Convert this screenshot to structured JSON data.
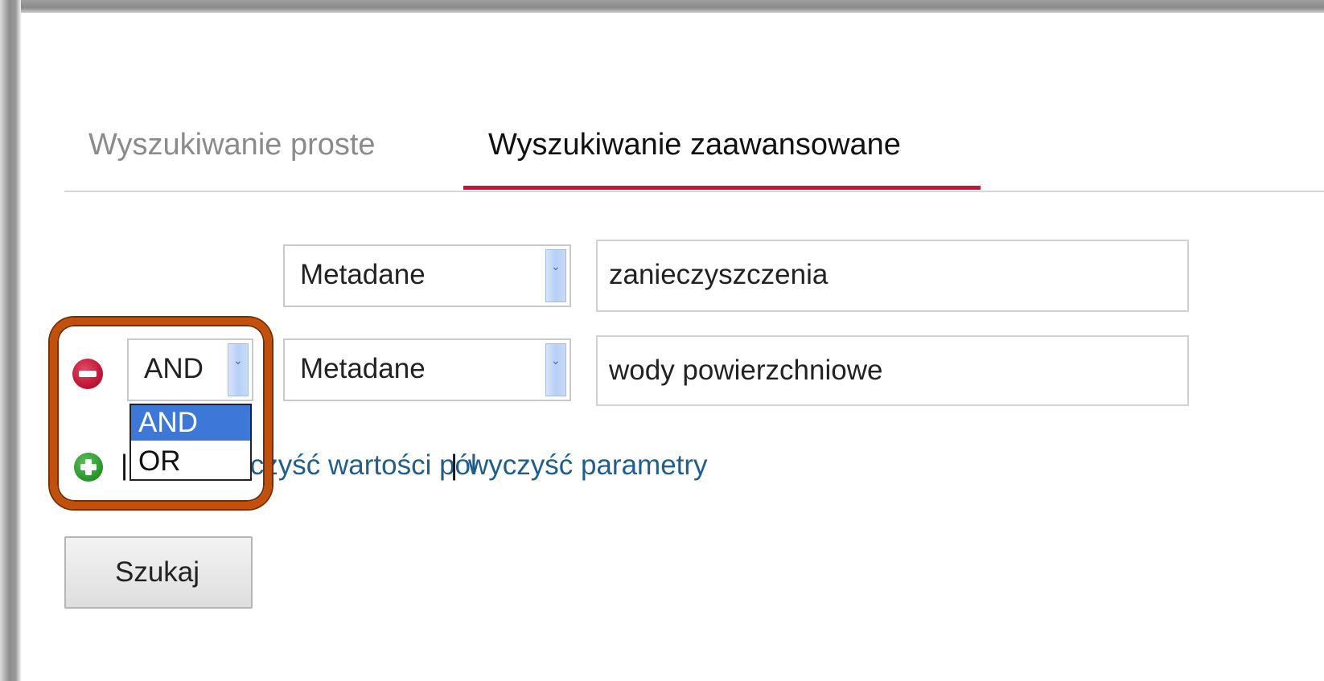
{
  "tabs": [
    {
      "label": "Wyszukiwanie proste"
    },
    {
      "label": "Wyszukiwanie zaawansowane"
    }
  ],
  "rows": [
    {
      "field": "Metadane",
      "value": "zanieczyszczenia"
    },
    {
      "operator": "AND",
      "field": "Metadane",
      "value": "wody powierzchniowe"
    }
  ],
  "operator_dropdown": {
    "options": [
      "AND",
      "OR"
    ],
    "selected": "AND"
  },
  "links": {
    "separator": "|",
    "clear_values": "wyczyść wartości pól",
    "clear_params": "wyczyść parametry"
  },
  "search_button": "Szukaj",
  "colors": {
    "active_tab_underline": "#c8143c",
    "link": "#1f5e8e",
    "highlight_border": "#c24f0a",
    "selected_option": "#3d78d8"
  },
  "icons": {
    "remove_row": "minus-circle-icon",
    "add_row": "plus-circle-icon",
    "dropdown": "chevron-down-icon"
  }
}
